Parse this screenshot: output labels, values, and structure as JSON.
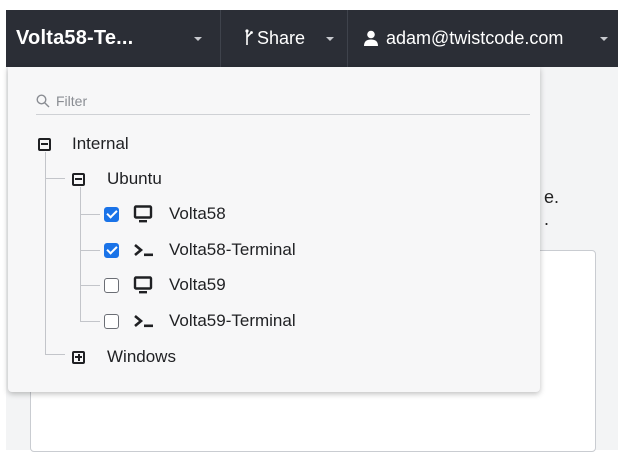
{
  "topbar": {
    "connection_name": "Volta58-Te...",
    "share_label": "Share",
    "user_label": "adam@twistcode.com"
  },
  "background": {
    "line1_fragment": "e.",
    "line2_fragment": "."
  },
  "menu": {
    "filter_placeholder": "Filter",
    "filter_value": "",
    "tree": {
      "group_internal": "Internal",
      "group_ubuntu": "Ubuntu",
      "items": [
        {
          "label": "Volta58",
          "icon": "desktop-icon",
          "checked": true
        },
        {
          "label": "Volta58-Terminal",
          "icon": "terminal-icon",
          "checked": true
        },
        {
          "label": "Volta59",
          "icon": "desktop-icon",
          "checked": false
        },
        {
          "label": "Volta59-Terminal",
          "icon": "terminal-icon",
          "checked": false
        }
      ],
      "group_windows": "Windows"
    }
  },
  "colors": {
    "topbar_bg": "#2b2e36",
    "checkbox_checked": "#1a73e8",
    "menu_bg": "#f7f7f8"
  }
}
